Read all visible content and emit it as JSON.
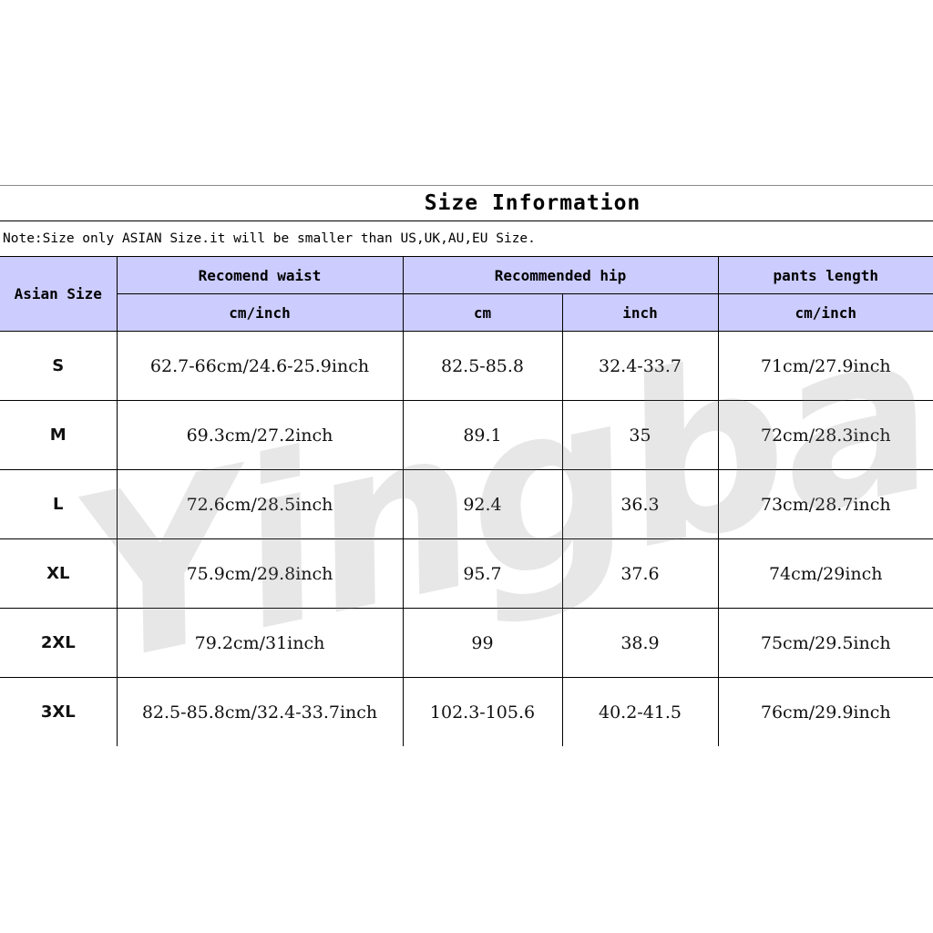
{
  "title": "Size Information",
  "note": "Note:Size only ASIAN Size.it will be smaller than US,UK,AU,EU Size.",
  "watermark": "Yingbao",
  "header": {
    "size_label": "Asian Size",
    "waist": "Recomend waist",
    "hip": "Recommended hip",
    "length": "pants length",
    "waist_unit": "cm/inch",
    "hip_unit_cm": "cm",
    "hip_unit_inch": "inch",
    "length_unit": "cm/inch"
  },
  "rows": [
    {
      "size": "S",
      "waist": "62.7-66cm/24.6-25.9inch",
      "hip_cm": "82.5-85.8",
      "hip_inch": "32.4-33.7",
      "length": "71cm/27.9inch"
    },
    {
      "size": "M",
      "waist": "69.3cm/27.2inch",
      "hip_cm": "89.1",
      "hip_inch": "35",
      "length": "72cm/28.3inch"
    },
    {
      "size": "L",
      "waist": "72.6cm/28.5inch",
      "hip_cm": "92.4",
      "hip_inch": "36.3",
      "length": "73cm/28.7inch"
    },
    {
      "size": "XL",
      "waist": "75.9cm/29.8inch",
      "hip_cm": "95.7",
      "hip_inch": "37.6",
      "length": "74cm/29inch"
    },
    {
      "size": "2XL",
      "waist": "79.2cm/31inch",
      "hip_cm": "99",
      "hip_inch": "38.9",
      "length": "75cm/29.5inch"
    },
    {
      "size": "3XL",
      "waist": "82.5-85.8cm/32.4-33.7inch",
      "hip_cm": "102.3-105.6",
      "hip_inch": "40.2-41.5",
      "length": "76cm/29.9inch"
    }
  ],
  "colors": {
    "header_bg": "#ccccff",
    "text": "#000000"
  }
}
